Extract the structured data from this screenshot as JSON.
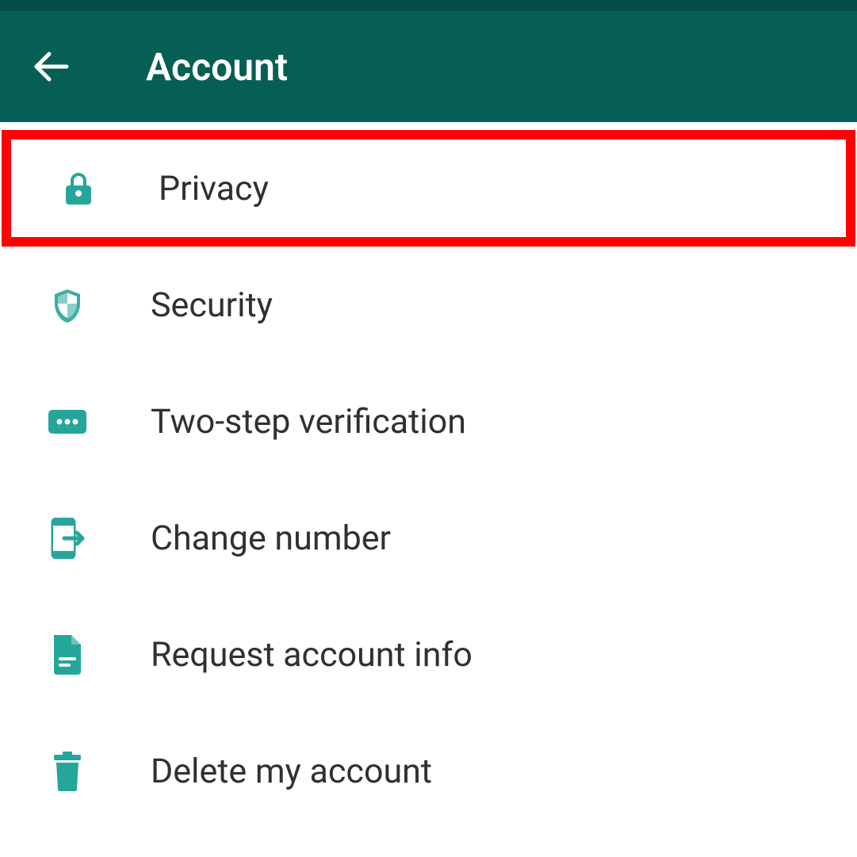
{
  "header": {
    "title": "Account"
  },
  "items": [
    {
      "label": "Privacy",
      "icon": "lock",
      "highlighted": true
    },
    {
      "label": "Security",
      "icon": "shield",
      "highlighted": false
    },
    {
      "label": "Two-step verification",
      "icon": "dots",
      "highlighted": false
    },
    {
      "label": "Change number",
      "icon": "phone-arrow",
      "highlighted": false
    },
    {
      "label": "Request account info",
      "icon": "document",
      "highlighted": false
    },
    {
      "label": "Delete my account",
      "icon": "trash",
      "highlighted": false
    }
  ]
}
